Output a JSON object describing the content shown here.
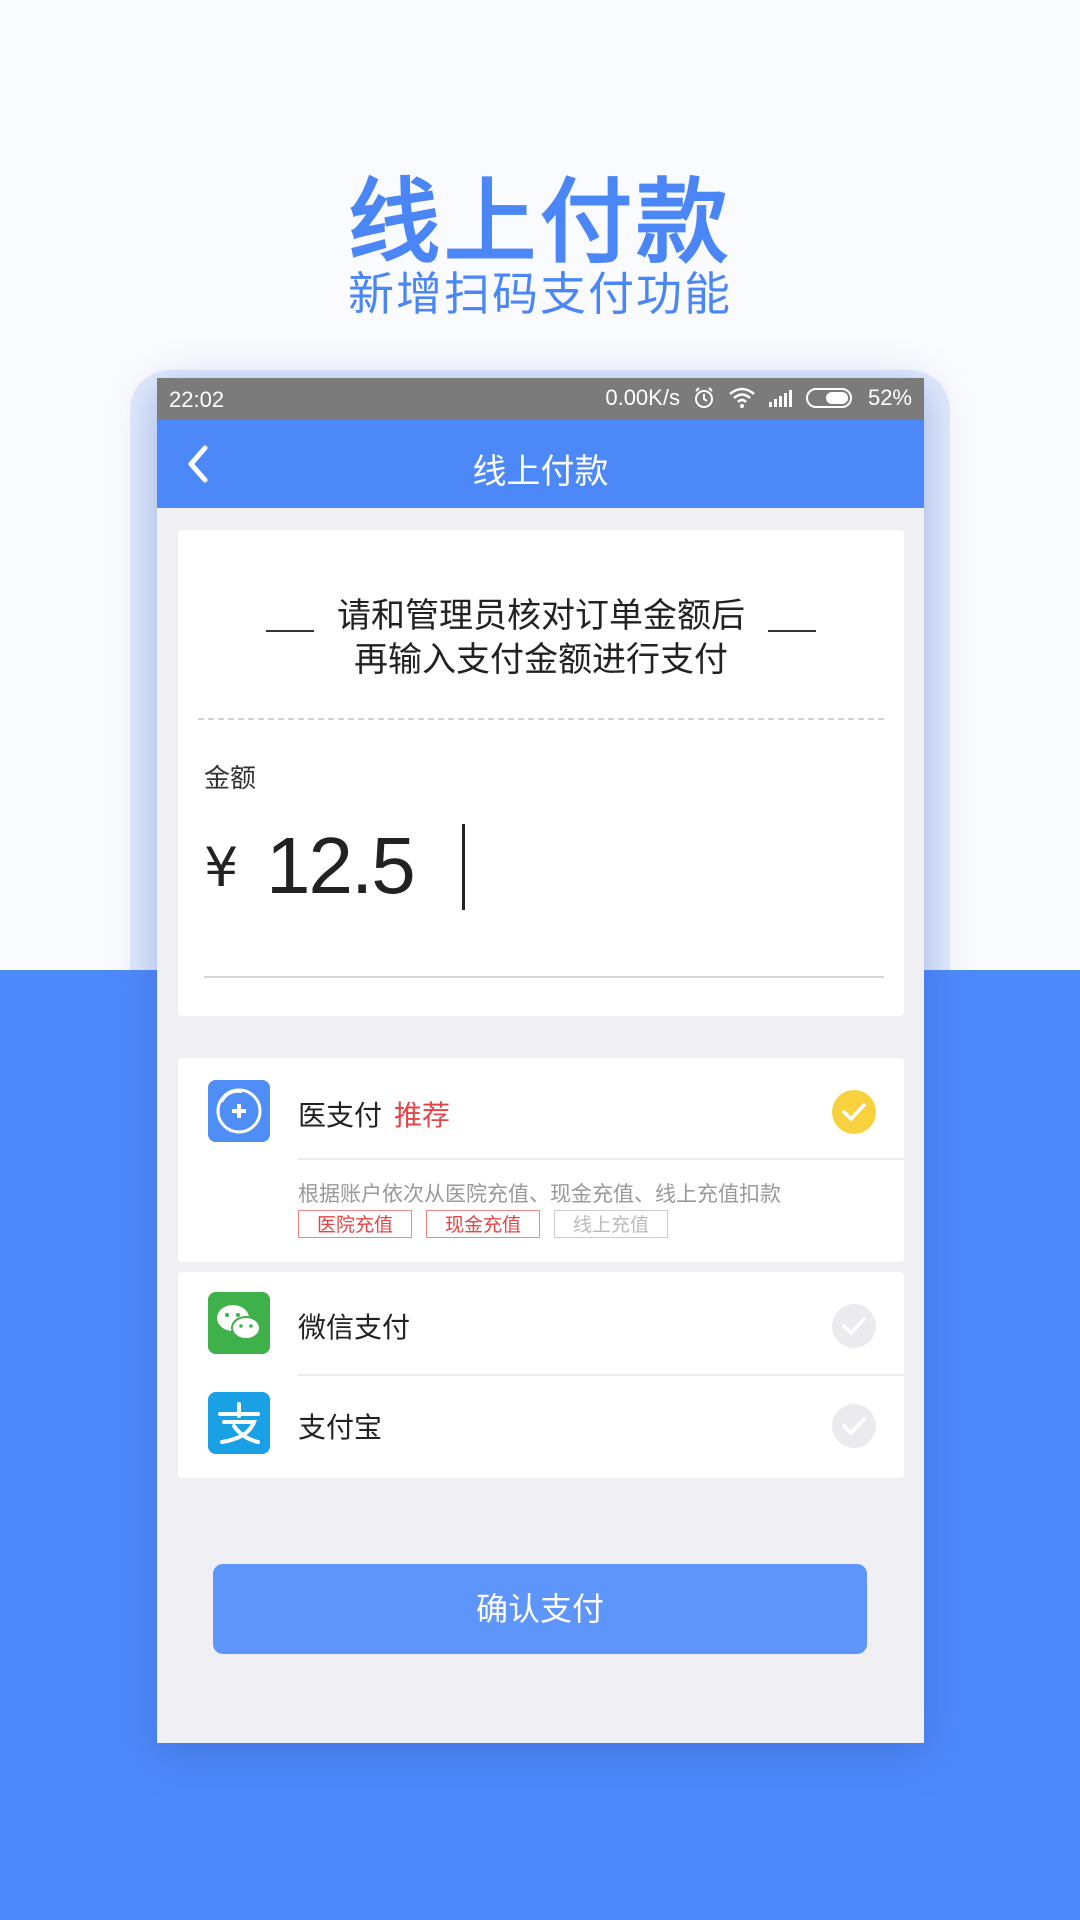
{
  "hero": {
    "title": "线上付款",
    "subtitle": "新增扫码支付功能"
  },
  "statusbar": {
    "time": "22:02",
    "network_speed": "0.00K/s",
    "battery": "52%"
  },
  "navbar": {
    "title": "线上付款"
  },
  "notice": {
    "line1": "请和管理员核对订单金额后",
    "line2": "再输入支付金额进行支付"
  },
  "amount": {
    "label": "金额",
    "currency": "¥",
    "value": "12.5"
  },
  "payment_methods": [
    {
      "name": "医支付",
      "badge": "推荐",
      "selected": true,
      "icon": "medical-pay-icon",
      "description": "根据账户依次从医院充值、现金充值、线上充值扣款",
      "tags": [
        {
          "label": "医院充值",
          "active": true
        },
        {
          "label": "现金充值",
          "active": true
        },
        {
          "label": "线上充值",
          "active": false
        }
      ]
    },
    {
      "name": "微信支付",
      "selected": false,
      "icon": "wechat-pay-icon"
    },
    {
      "name": "支付宝",
      "selected": false,
      "icon": "alipay-icon"
    }
  ],
  "confirm_button": "确认支付",
  "colors": {
    "primary": "#4d88f9",
    "background_blue": "#4e89fb",
    "selected_check": "#f7d23e",
    "badge_red": "#e64545",
    "wechat_green": "#3fb14a",
    "alipay_blue": "#1aa1e5"
  }
}
